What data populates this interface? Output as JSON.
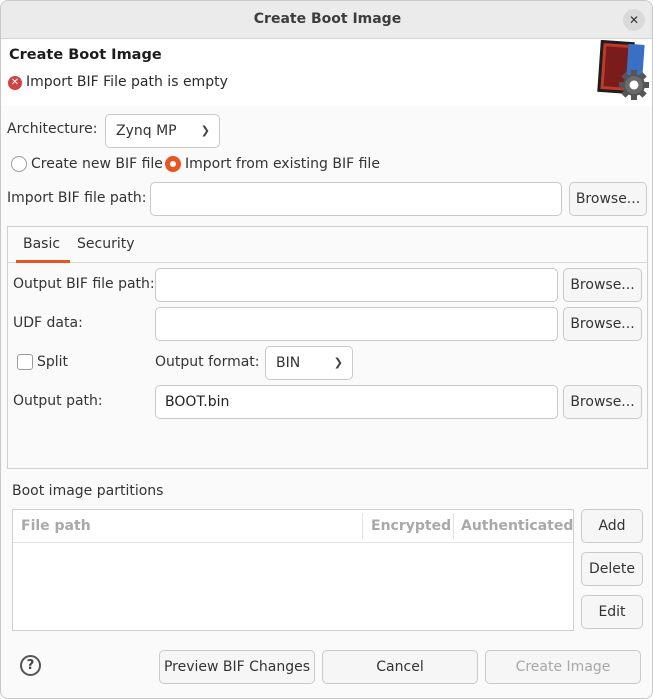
{
  "window": {
    "title": "Create Boot Image",
    "close_glyph": "✕"
  },
  "header": {
    "title": "Create Boot Image",
    "message": "Import BIF File path is empty",
    "error_icon": "error-icon",
    "banner_icon": "boot-image-gear-icon"
  },
  "architecture": {
    "label": "Architecture:",
    "value": "Zynq MP"
  },
  "bif_mode": {
    "create_label": "Create new BIF file",
    "import_label": "Import from existing BIF file",
    "selected": "import"
  },
  "import_bif": {
    "label": "Import BIF file path:",
    "value": "",
    "browse": "Browse..."
  },
  "tabs": [
    {
      "label": "Basic",
      "active": true
    },
    {
      "label": "Security",
      "active": false
    }
  ],
  "basic": {
    "output_bif": {
      "label": "Output BIF file path:",
      "value": "",
      "browse": "Browse..."
    },
    "udf": {
      "label": "UDF data:",
      "value": "",
      "browse": "Browse..."
    },
    "split": {
      "label": "Split",
      "checked": false
    },
    "output_format": {
      "label": "Output format:",
      "value": "BIN"
    },
    "output_path": {
      "label": "Output path:",
      "value": "BOOT.bin",
      "browse": "Browse..."
    }
  },
  "partitions": {
    "label": "Boot image partitions",
    "columns": [
      "File path",
      "Encrypted",
      "Authenticated"
    ],
    "rows": [],
    "buttons": {
      "add": "Add",
      "delete": "Delete",
      "edit": "Edit"
    }
  },
  "footer": {
    "help": "?",
    "preview": "Preview BIF Changes",
    "cancel": "Cancel",
    "create": "Create Image"
  },
  "colors": {
    "accent": "#e95420",
    "error": "#d14343"
  }
}
